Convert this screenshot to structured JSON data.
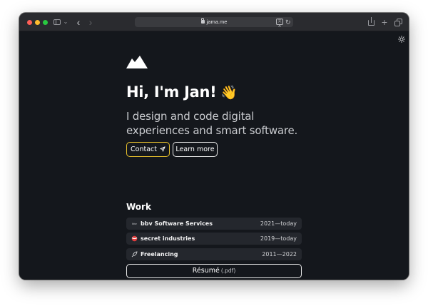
{
  "browser": {
    "url": "jama.me",
    "icons": [
      "sidebar-icon",
      "chevron-down-icon",
      "back-arrow-icon",
      "forward-arrow-icon",
      "lock-icon",
      "translate-icon",
      "reload-icon",
      "share-icon",
      "plus-icon",
      "tabs-overview-icon"
    ]
  },
  "page": {
    "theme_toggle_icon": "sun-icon",
    "logo_icon": "mountain-logo",
    "greeting": "Hi, I'm Jan!",
    "wave_emoji": "👋",
    "tagline": "I design and code digital experiences and smart software.",
    "buttons": {
      "contact_label": "Contact",
      "contact_icon": "paper-plane-icon",
      "learn_more_label": "Learn more"
    },
    "accent_color": "#e7c02c",
    "work": {
      "title": "Work",
      "items": [
        {
          "icon_text": "bbv",
          "name": "bbv Software Services",
          "years": "2021—today"
        },
        {
          "icon": "red-ball-icon",
          "name": "secret industries",
          "years": "2019—today"
        },
        {
          "icon": "rocket-icon",
          "name": "Freelancing",
          "years": "2011—2022"
        }
      ]
    },
    "resume": {
      "label": "Résumé",
      "ext": "(.pdf)"
    }
  }
}
